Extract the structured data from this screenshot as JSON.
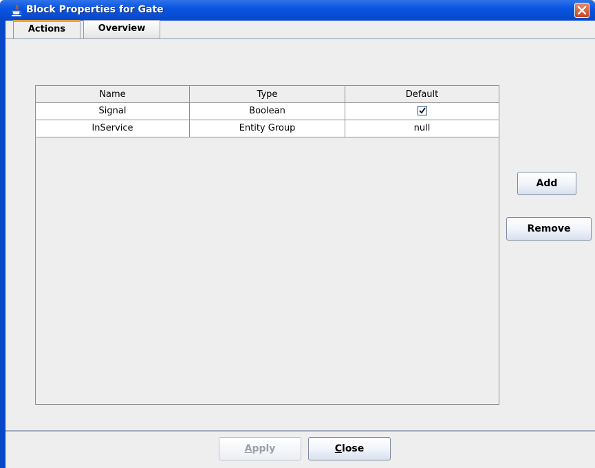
{
  "window": {
    "title": "Block Properties for Gate",
    "icon": "java-cup-icon",
    "close_icon": "close-icon"
  },
  "tabs": [
    {
      "label": "Actions",
      "selected": true
    },
    {
      "label": "Overview",
      "selected": false
    }
  ],
  "table": {
    "columns": [
      "Name",
      "Type",
      "Default"
    ],
    "rows": [
      {
        "name": "Signal",
        "type": "Boolean",
        "default": "",
        "default_checked": true
      },
      {
        "name": "InService",
        "type": "Entity Group",
        "default": "null"
      }
    ]
  },
  "buttons": {
    "add": "Add",
    "remove": "Remove",
    "apply": {
      "label_pre": "",
      "mnemonic": "A",
      "label_post": "pply",
      "enabled": false
    },
    "close": {
      "label_pre": "",
      "mnemonic": "C",
      "label_post": "lose",
      "enabled": true
    }
  },
  "colors": {
    "titlebar": "#0a55e2",
    "tab_accent": "#e9a13a",
    "panel_bg": "#eeeeee"
  }
}
